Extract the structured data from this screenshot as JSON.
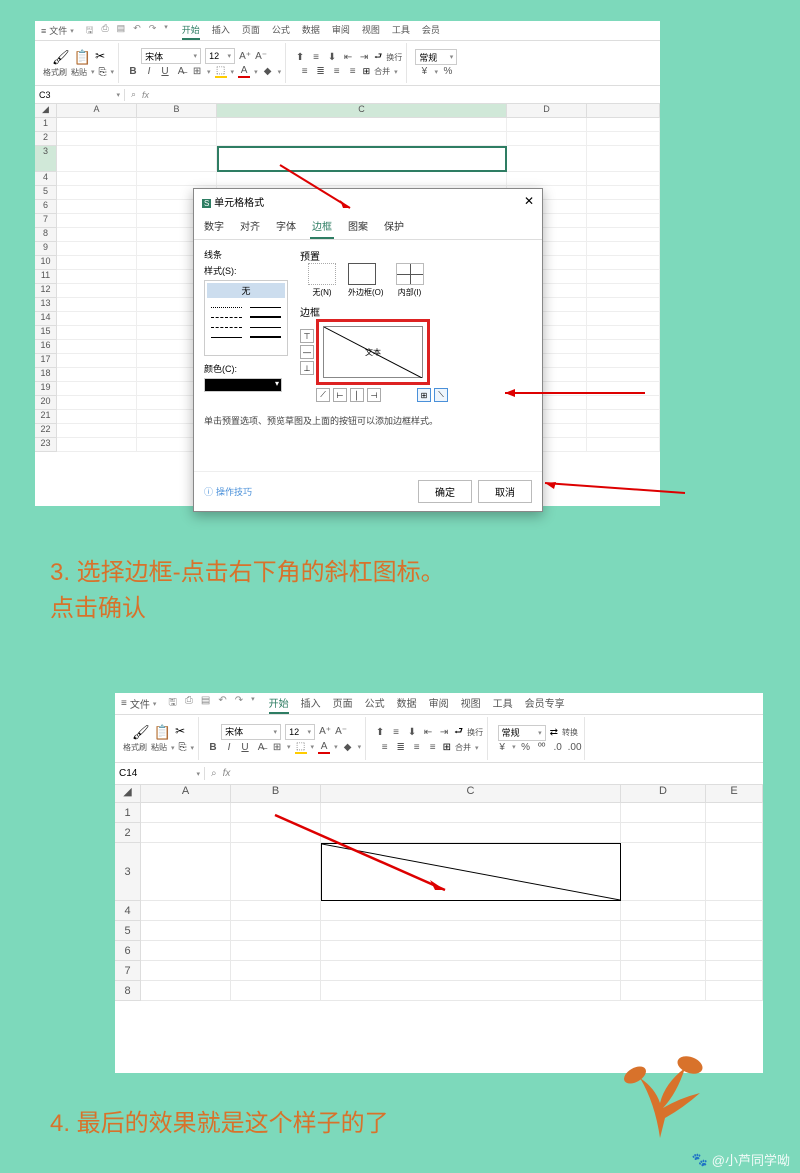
{
  "menubar": {
    "file": "文件",
    "tabs": [
      "开始",
      "插入",
      "页面",
      "公式",
      "数据",
      "审阅",
      "视图",
      "工具",
      "会员"
    ],
    "tabs2": [
      "开始",
      "插入",
      "页面",
      "公式",
      "数据",
      "审阅",
      "视图",
      "工具",
      "会员专享"
    ],
    "active": "开始"
  },
  "ribbon": {
    "format_painter": "格式刷",
    "paste": "粘贴",
    "font": "宋体",
    "size": "12",
    "wrap": "换行",
    "merge": "合并",
    "normal": "常规",
    "convert": "转换"
  },
  "namebox1": "C3",
  "namebox2": "C14",
  "fx": "fx",
  "cols": [
    "A",
    "B",
    "C",
    "D",
    "E"
  ],
  "rows1": [
    "1",
    "2",
    "3",
    "4",
    "5",
    "6",
    "7",
    "8",
    "9",
    "10",
    "11",
    "12",
    "13",
    "14",
    "15",
    "16",
    "17",
    "18",
    "19",
    "20",
    "21",
    "22",
    "23"
  ],
  "rows2": [
    "1",
    "2",
    "3",
    "4",
    "5",
    "6",
    "7",
    "8"
  ],
  "dialog": {
    "title": "单元格格式",
    "tabs": [
      "数字",
      "对齐",
      "字体",
      "边框",
      "图案",
      "保护"
    ],
    "active_tab": "边框",
    "line_label": "线条",
    "style_label": "样式(S):",
    "style_none": "无",
    "color_label": "颜色(C):",
    "preset_label": "预置",
    "preset_none": "无(N)",
    "preset_outer": "外边框(O)",
    "preset_inner": "内部(I)",
    "border_label": "边框",
    "preview_text": "文本",
    "hint": "单击预置选项、预览草图及上面的按钮可以添加边框样式。",
    "tips": "操作技巧",
    "ok": "确定",
    "cancel": "取消"
  },
  "instructions": {
    "step3": "3. 选择边框-点击右下角的斜杠图标。\n点击确认",
    "step4": "4. 最后的效果就是这个样子的了"
  },
  "watermark": "@小芦同学呦"
}
